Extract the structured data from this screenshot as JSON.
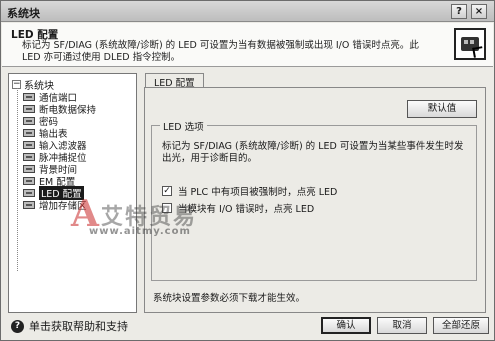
{
  "window": {
    "title": "系统块",
    "help_glyph": "?",
    "close_glyph": "×"
  },
  "header": {
    "title": "LED 配置",
    "description": "标记为 SF/DIAG (系统故障/诊断) 的 LED 可设置为当有数据被强制或出现 I/O 错误时点亮。此 LED 亦可通过使用 DLED 指令控制。",
    "icon": "led-panel-icon"
  },
  "tree": {
    "root_label": "系统块",
    "expander": "−",
    "items": [
      {
        "label": "通信端口",
        "icon": "module-icon",
        "selected": false
      },
      {
        "label": "断电数据保持",
        "icon": "module-icon",
        "selected": false
      },
      {
        "label": "密码",
        "icon": "module-icon",
        "selected": false
      },
      {
        "label": "输出表",
        "icon": "module-icon",
        "selected": false
      },
      {
        "label": "输入滤波器",
        "icon": "module-icon",
        "selected": false
      },
      {
        "label": "脉冲捕捉位",
        "icon": "module-icon",
        "selected": false
      },
      {
        "label": "背景时间",
        "icon": "module-icon",
        "selected": false
      },
      {
        "label": "EM 配置",
        "icon": "module-icon",
        "selected": false
      },
      {
        "label": "LED 配置",
        "icon": "module-icon",
        "selected": true
      },
      {
        "label": "增加存储区",
        "icon": "module-icon",
        "selected": false
      }
    ]
  },
  "tabs": [
    {
      "label": "LED 配置",
      "active": true
    }
  ],
  "panel": {
    "default_button": "默认值",
    "group_title": "LED 选项",
    "group_description": "标记为 SF/DIAG (系统故障/诊断) 的 LED 可设置为当某些事件发生时发出光，用于诊断目的。",
    "options": [
      {
        "label": "当 PLC 中有项目被强制时，点亮 LED",
        "checked": true,
        "mark": "✓"
      },
      {
        "label": "当模块有 I/O 错误时，点亮 LED",
        "checked": false,
        "mark": ""
      }
    ],
    "note": "系统块设置参数必须下载才能生效。"
  },
  "footer": {
    "help_icon": "help-circle-icon",
    "help_glyph": "?",
    "help_text": "单击获取帮助和支持",
    "ok": "确认",
    "cancel": "取消",
    "restore_all": "全部还原"
  },
  "watermark": {
    "logo_letter": "A",
    "brand": "艾特贸易",
    "url": "www.aitmy.com"
  },
  "colors": {
    "window_bg": "#ecebe6",
    "selection_bg": "#1b1b1b",
    "watermark_red": "#c82828"
  }
}
